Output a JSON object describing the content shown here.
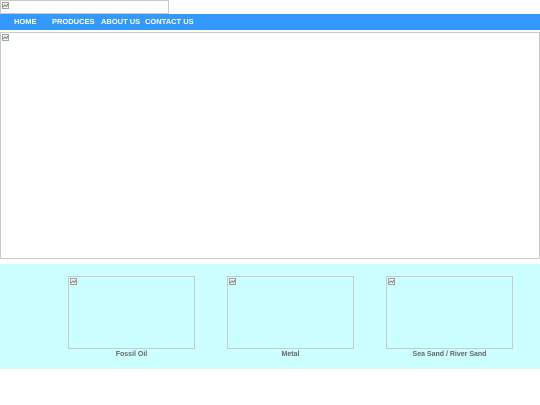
{
  "nav": {
    "items": [
      {
        "label": "HOME"
      },
      {
        "label": "PRODUCES"
      },
      {
        "label": "ABOUT US"
      },
      {
        "label": "CONTACT US"
      }
    ]
  },
  "products": [
    {
      "caption": "Fossil Oil"
    },
    {
      "caption": "Metal"
    },
    {
      "caption": "Sea Sand / River Sand"
    }
  ],
  "colors": {
    "nav_background": "#3399ff",
    "nav_text": "#ffffff",
    "products_background": "#ccffff",
    "caption_text": "#666666"
  }
}
